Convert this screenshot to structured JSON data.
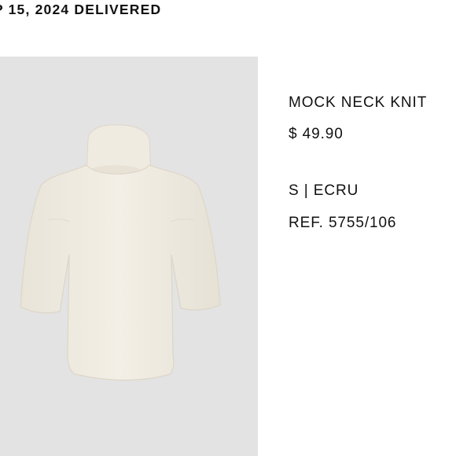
{
  "order": {
    "status_text": "P 15, 2024 DELIVERED"
  },
  "product": {
    "image_icon": "knit-sweater-image",
    "name": "MOCK NECK KNIT",
    "price": "$ 49.90",
    "variant": "S | ECRU",
    "reference": "REF. 5755/106"
  },
  "colors": {
    "image_background": "#e3e3e3",
    "garment": "#f1ede3",
    "text": "#111111"
  }
}
